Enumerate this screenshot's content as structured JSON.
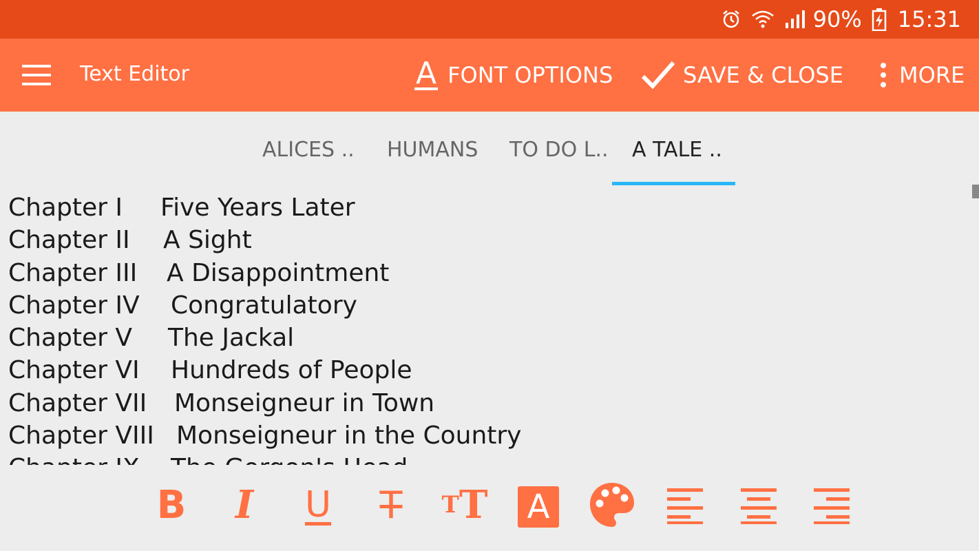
{
  "status_bar": {
    "battery": "90%",
    "time": "15:31",
    "icons": [
      "alarm-icon",
      "wifi-icon",
      "signal-icon",
      "battery-charging-icon"
    ]
  },
  "toolbar": {
    "title": "Text Editor",
    "font_options_label": "FONT OPTIONS",
    "font_options_icon_glyph": "A",
    "save_close_label": "SAVE & CLOSE",
    "more_label": "MORE"
  },
  "tabs": [
    {
      "label": "ALICES ..",
      "active": false
    },
    {
      "label": "HUMANS",
      "active": false
    },
    {
      "label": "TO DO L..",
      "active": false
    },
    {
      "label": "A TALE ..",
      "active": true
    }
  ],
  "document": {
    "lines": [
      {
        "chapter": "Chapter I",
        "title": "Five Years Later"
      },
      {
        "chapter": "Chapter II",
        "title": "A Sight"
      },
      {
        "chapter": "Chapter III",
        "title": "A Disappointment"
      },
      {
        "chapter": "Chapter IV",
        "title": "Congratulatory"
      },
      {
        "chapter": "Chapter V",
        "title": "The Jackal"
      },
      {
        "chapter": "Chapter VI",
        "title": "Hundreds of People"
      },
      {
        "chapter": "Chapter VII",
        "title": "Monseigneur in Town"
      },
      {
        "chapter": "Chapter VIII",
        "title": "Monseigneur in the Country"
      },
      {
        "chapter": "Chapter IX",
        "title": "The Gorgon's Head"
      }
    ]
  },
  "format_bar": {
    "bold_glyph": "B",
    "italic_glyph": "I",
    "underline_glyph": "U",
    "strike_glyph": "T",
    "text_size_small_glyph": "T",
    "text_size_big_glyph": "T",
    "text_color_glyph": "A"
  },
  "colors": {
    "status_bar": "#e64a19",
    "toolbar": "#ff7043",
    "accent": "#ff7043",
    "tab_indicator": "#29b6f6",
    "background": "#ededed"
  }
}
